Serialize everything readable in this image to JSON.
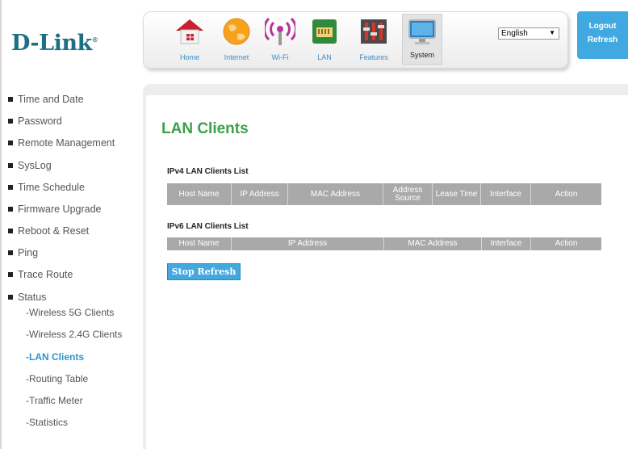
{
  "brand": {
    "logo_text": "D-Link",
    "logo_mark": "®"
  },
  "nav": [
    {
      "label": "Home",
      "icon": "home-icon"
    },
    {
      "label": "Internet",
      "icon": "globe-icon"
    },
    {
      "label": "Wi-Fi",
      "icon": "wifi-icon"
    },
    {
      "label": "LAN",
      "icon": "lan-icon"
    },
    {
      "label": "Features",
      "icon": "features-icon"
    },
    {
      "label": "System",
      "icon": "monitor-icon",
      "active": true
    }
  ],
  "language": {
    "selected": "English"
  },
  "account": {
    "logout": "Logout",
    "refresh": "Refresh"
  },
  "sidebar": {
    "items": [
      "Time and Date",
      "Password",
      "Remote Management",
      "SysLog",
      "Time Schedule",
      "Firmware Upgrade",
      "Reboot & Reset",
      "Ping",
      "Trace Route",
      "Status"
    ],
    "status_sub": [
      "-Wireless 5G Clients",
      "-Wireless 2.4G Clients",
      "-LAN Clients",
      "-Routing Table",
      "-Traffic Meter",
      "-Statistics"
    ],
    "active_sub": "-LAN Clients"
  },
  "main": {
    "title": "LAN Clients",
    "ipv4": {
      "title": "IPv4 LAN Clients List",
      "columns": [
        "Host Name",
        "IP Address",
        "MAC Address",
        "Address Source",
        "Lease Time",
        "Interface",
        "Action"
      ]
    },
    "ipv6": {
      "title": "IPv6 LAN Clients List",
      "columns": [
        "Host Name",
        "IP Address",
        "MAC Address",
        "Interface",
        "Action"
      ]
    },
    "stop_refresh": "Stop Refresh"
  },
  "colors": {
    "brand": "#1f6f84",
    "title_green": "#3ea04a",
    "accent_blue": "#42a8df",
    "table_header": "#a9a9a9"
  }
}
